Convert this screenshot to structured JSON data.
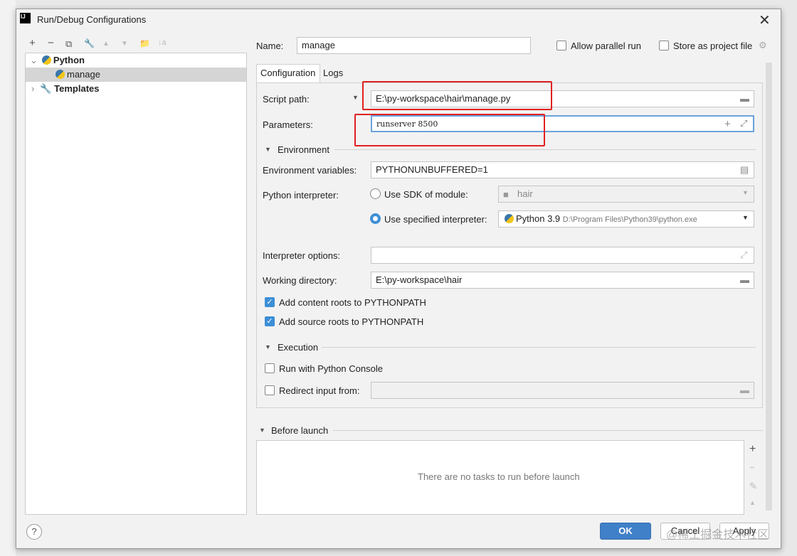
{
  "window": {
    "title": "Run/Debug Configurations",
    "logo": "IJ"
  },
  "toolbar": {
    "add": "+",
    "remove": "−",
    "copy": "⧉",
    "edit": "🔧",
    "up": "▲",
    "down": "▼",
    "folder": "📁",
    "sort": "↓a"
  },
  "tree": [
    {
      "label": "Python",
      "expanded": true
    },
    {
      "label": "manage",
      "selected": true
    },
    {
      "label": "Templates",
      "expanded": false
    }
  ],
  "name": {
    "label": "Name:",
    "value": "manage"
  },
  "allow_parallel": {
    "label": "Allow parallel run",
    "checked": false
  },
  "store_project": {
    "label": "Store as project file",
    "checked": false
  },
  "tabs": [
    "Configuration",
    "Logs"
  ],
  "script_path": {
    "label": "Script path:",
    "value": "E:\\py-workspace\\hair\\manage.py"
  },
  "parameters": {
    "label": "Parameters:",
    "value": "runserver 8500"
  },
  "environment": {
    "section": "Environment",
    "env_label": "Environment variables:",
    "env_value": "PYTHONUNBUFFERED=1",
    "interp_label": "Python interpreter:",
    "sdk_label": "Use SDK of module:",
    "sdk_value": "hair",
    "specified_label": "Use specified interpreter:",
    "interp_name": "Python 3.9",
    "interp_path": "D:\\Program Files\\Python39\\python.exe",
    "options_label": "Interpreter options:",
    "options_value": "",
    "workdir_label": "Working directory:",
    "workdir_value": "E:\\py-workspace\\hair",
    "content_roots": "Add content roots to PYTHONPATH",
    "source_roots": "Add source roots to PYTHONPATH"
  },
  "execution": {
    "section": "Execution",
    "console": "Run with Python Console",
    "redirect": "Redirect input from:"
  },
  "before_launch": {
    "section": "Before launch",
    "empty": "There are no tasks to run before launch"
  },
  "buttons": {
    "ok": "OK",
    "cancel": "Cancel",
    "apply": "Apply",
    "help": "?"
  },
  "watermark": "@稀土掘金技术社区"
}
